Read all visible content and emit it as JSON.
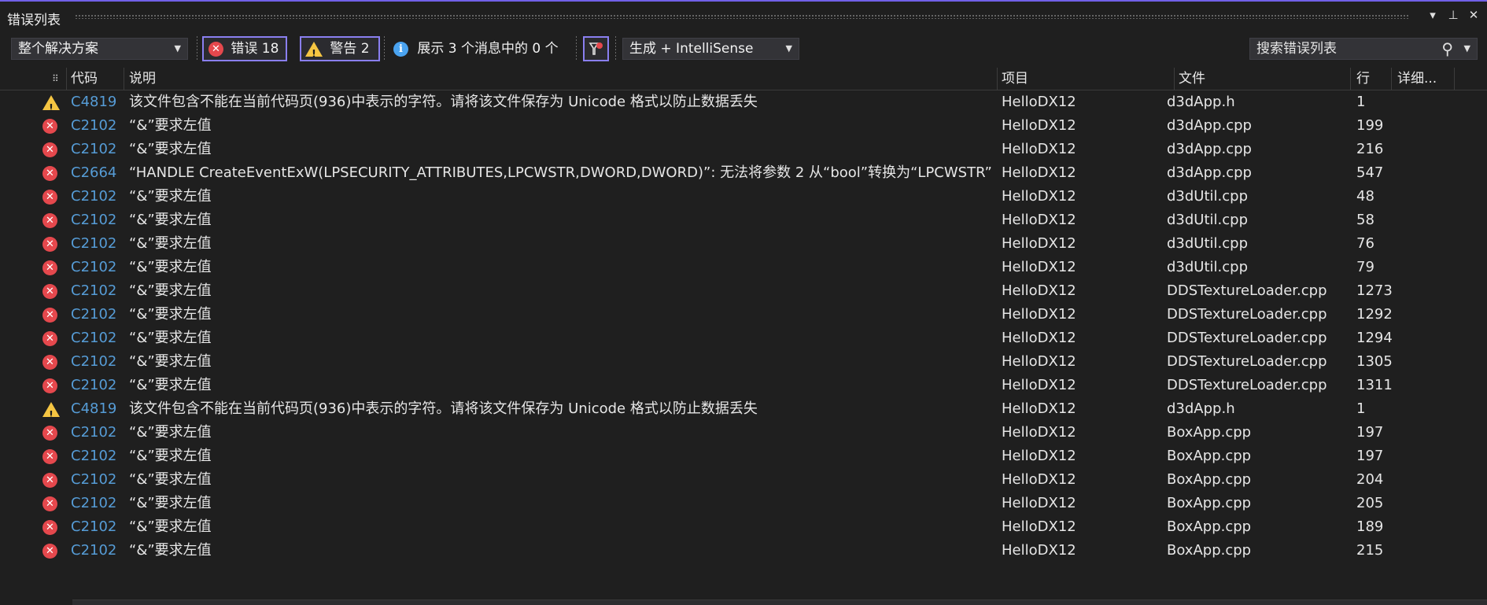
{
  "window": {
    "title": "错误列表",
    "title_buttons": [
      "▾",
      "⊥",
      "✕"
    ]
  },
  "toolbar": {
    "scope": "整个解决方案",
    "errors_label": "错误 18",
    "warnings_label": "警告 2",
    "messages_label": "展示 3 个消息中的 0 个",
    "build_filter": "生成 + IntelliSense",
    "search_placeholder": "搜索错误列表",
    "search_icon": "⚲"
  },
  "columns": {
    "code": "代码",
    "desc": "说明",
    "project": "项目",
    "file": "文件",
    "line": "行",
    "detail": "详细..."
  },
  "colors": {
    "accent": "#7160e8",
    "error": "#e5484d",
    "warning": "#f5c542",
    "info": "#4aa3f0",
    "code_link": "#569cd6"
  },
  "rows": [
    {
      "severity": "warning",
      "code": "C4819",
      "desc": "该文件包含不能在当前代码页(936)中表示的字符。请将该文件保存为 Unicode 格式以防止数据丢失",
      "project": "HelloDX12",
      "file": "d3dApp.h",
      "line": "1"
    },
    {
      "severity": "error",
      "code": "C2102",
      "desc": "“&”要求左值",
      "project": "HelloDX12",
      "file": "d3dApp.cpp",
      "line": "199"
    },
    {
      "severity": "error",
      "code": "C2102",
      "desc": "“&”要求左值",
      "project": "HelloDX12",
      "file": "d3dApp.cpp",
      "line": "216"
    },
    {
      "severity": "error",
      "code": "C2664",
      "desc": "“HANDLE CreateEventExW(LPSECURITY_ATTRIBUTES,LPCWSTR,DWORD,DWORD)”: 无法将参数 2 从“bool”转换为“LPCWSTR”",
      "project": "HelloDX12",
      "file": "d3dApp.cpp",
      "line": "547"
    },
    {
      "severity": "error",
      "code": "C2102",
      "desc": "“&”要求左值",
      "project": "HelloDX12",
      "file": "d3dUtil.cpp",
      "line": "48"
    },
    {
      "severity": "error",
      "code": "C2102",
      "desc": "“&”要求左值",
      "project": "HelloDX12",
      "file": "d3dUtil.cpp",
      "line": "58"
    },
    {
      "severity": "error",
      "code": "C2102",
      "desc": "“&”要求左值",
      "project": "HelloDX12",
      "file": "d3dUtil.cpp",
      "line": "76"
    },
    {
      "severity": "error",
      "code": "C2102",
      "desc": "“&”要求左值",
      "project": "HelloDX12",
      "file": "d3dUtil.cpp",
      "line": "79"
    },
    {
      "severity": "error",
      "code": "C2102",
      "desc": "“&”要求左值",
      "project": "HelloDX12",
      "file": "DDSTextureLoader.cpp",
      "line": "1273"
    },
    {
      "severity": "error",
      "code": "C2102",
      "desc": "“&”要求左值",
      "project": "HelloDX12",
      "file": "DDSTextureLoader.cpp",
      "line": "1292"
    },
    {
      "severity": "error",
      "code": "C2102",
      "desc": "“&”要求左值",
      "project": "HelloDX12",
      "file": "DDSTextureLoader.cpp",
      "line": "1294"
    },
    {
      "severity": "error",
      "code": "C2102",
      "desc": "“&”要求左值",
      "project": "HelloDX12",
      "file": "DDSTextureLoader.cpp",
      "line": "1305"
    },
    {
      "severity": "error",
      "code": "C2102",
      "desc": "“&”要求左值",
      "project": "HelloDX12",
      "file": "DDSTextureLoader.cpp",
      "line": "1311"
    },
    {
      "severity": "warning",
      "code": "C4819",
      "desc": "该文件包含不能在当前代码页(936)中表示的字符。请将该文件保存为 Unicode 格式以防止数据丢失",
      "project": "HelloDX12",
      "file": "d3dApp.h",
      "line": "1"
    },
    {
      "severity": "error",
      "code": "C2102",
      "desc": "“&”要求左值",
      "project": "HelloDX12",
      "file": "BoxApp.cpp",
      "line": "197"
    },
    {
      "severity": "error",
      "code": "C2102",
      "desc": "“&”要求左值",
      "project": "HelloDX12",
      "file": "BoxApp.cpp",
      "line": "197"
    },
    {
      "severity": "error",
      "code": "C2102",
      "desc": "“&”要求左值",
      "project": "HelloDX12",
      "file": "BoxApp.cpp",
      "line": "204"
    },
    {
      "severity": "error",
      "code": "C2102",
      "desc": "“&”要求左值",
      "project": "HelloDX12",
      "file": "BoxApp.cpp",
      "line": "205"
    },
    {
      "severity": "error",
      "code": "C2102",
      "desc": "“&”要求左值",
      "project": "HelloDX12",
      "file": "BoxApp.cpp",
      "line": "189"
    },
    {
      "severity": "error",
      "code": "C2102",
      "desc": "“&”要求左值",
      "project": "HelloDX12",
      "file": "BoxApp.cpp",
      "line": "215"
    }
  ]
}
